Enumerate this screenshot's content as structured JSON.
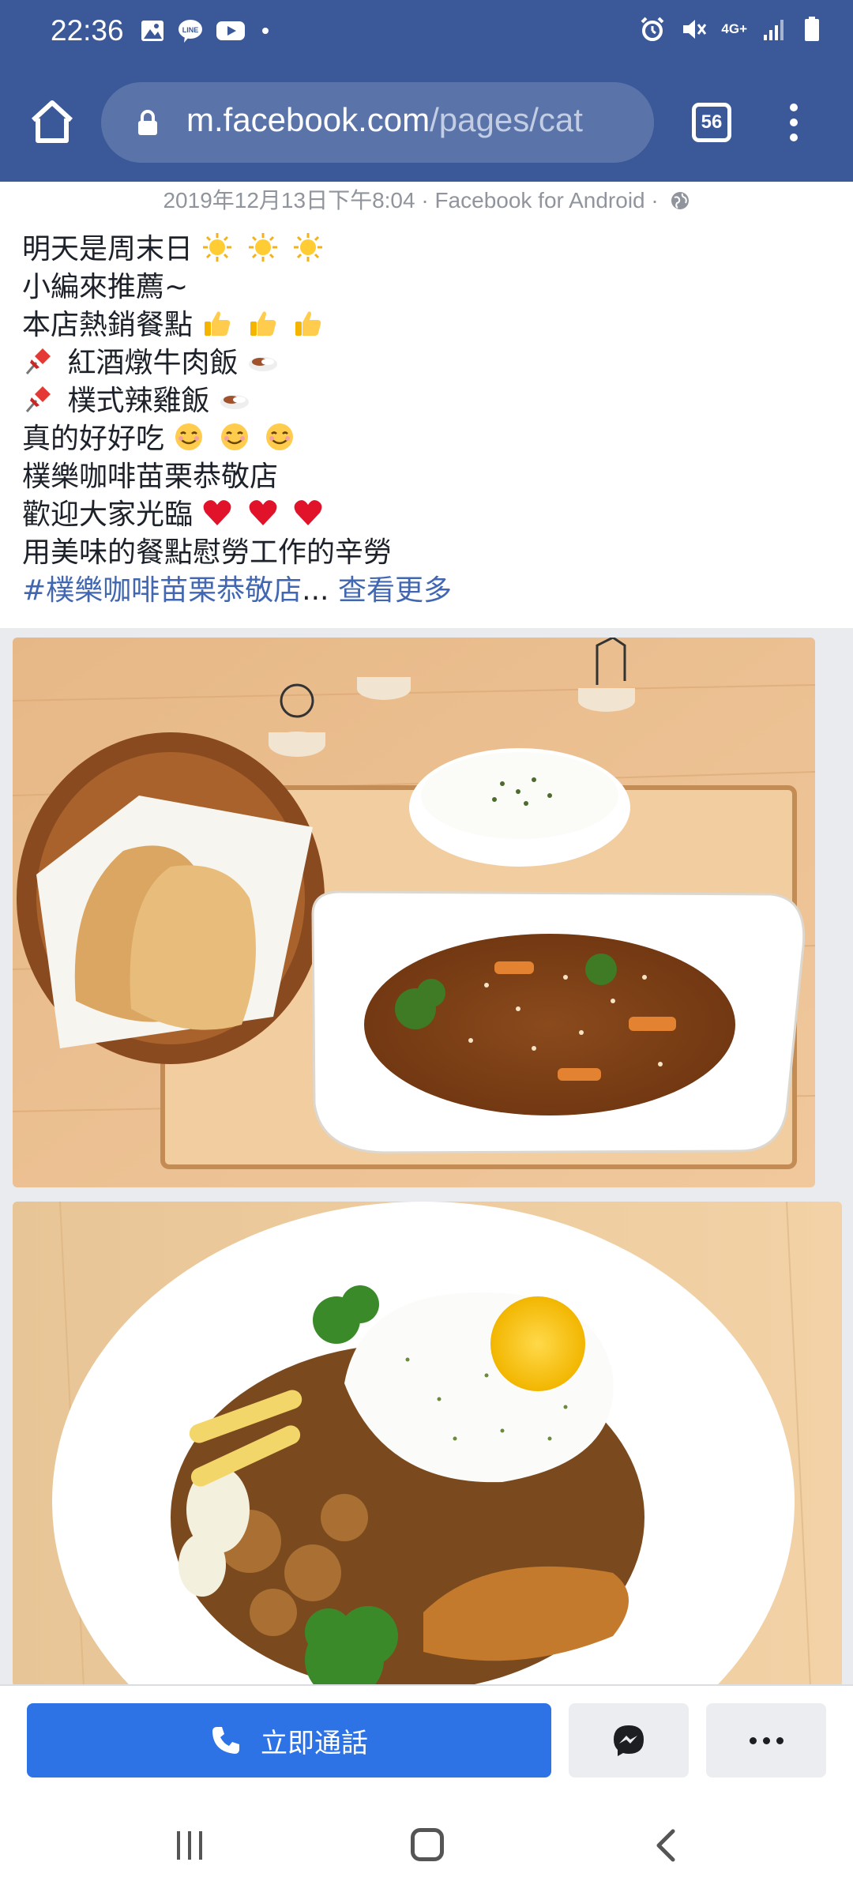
{
  "status_bar": {
    "time": "22:36",
    "network": "4G+"
  },
  "browser": {
    "url_host": "m.facebook.com",
    "url_path": "/pages/cat",
    "tab_count": "56"
  },
  "post": {
    "meta": "2019年12月13日下午8:04 · Facebook for Android ·",
    "lines": [
      "明天是周末日",
      "小編來推薦~",
      "本店熱銷餐點",
      "紅酒燉牛肉飯",
      "樸式辣雞飯",
      "真的好好吃",
      "樸樂咖啡苗栗恭敬店",
      "歡迎大家光臨",
      "用美味的餐點慰勞工作的辛勞"
    ],
    "hashtag": "#樸樂咖啡苗栗恭敬店",
    "ellipsis": "... ",
    "see_more": "查看更多"
  },
  "actions": {
    "call_label": "立即通話"
  },
  "colors": {
    "brand": "#3b5998",
    "call_button": "#2d73e6",
    "link": "#4267b2"
  }
}
